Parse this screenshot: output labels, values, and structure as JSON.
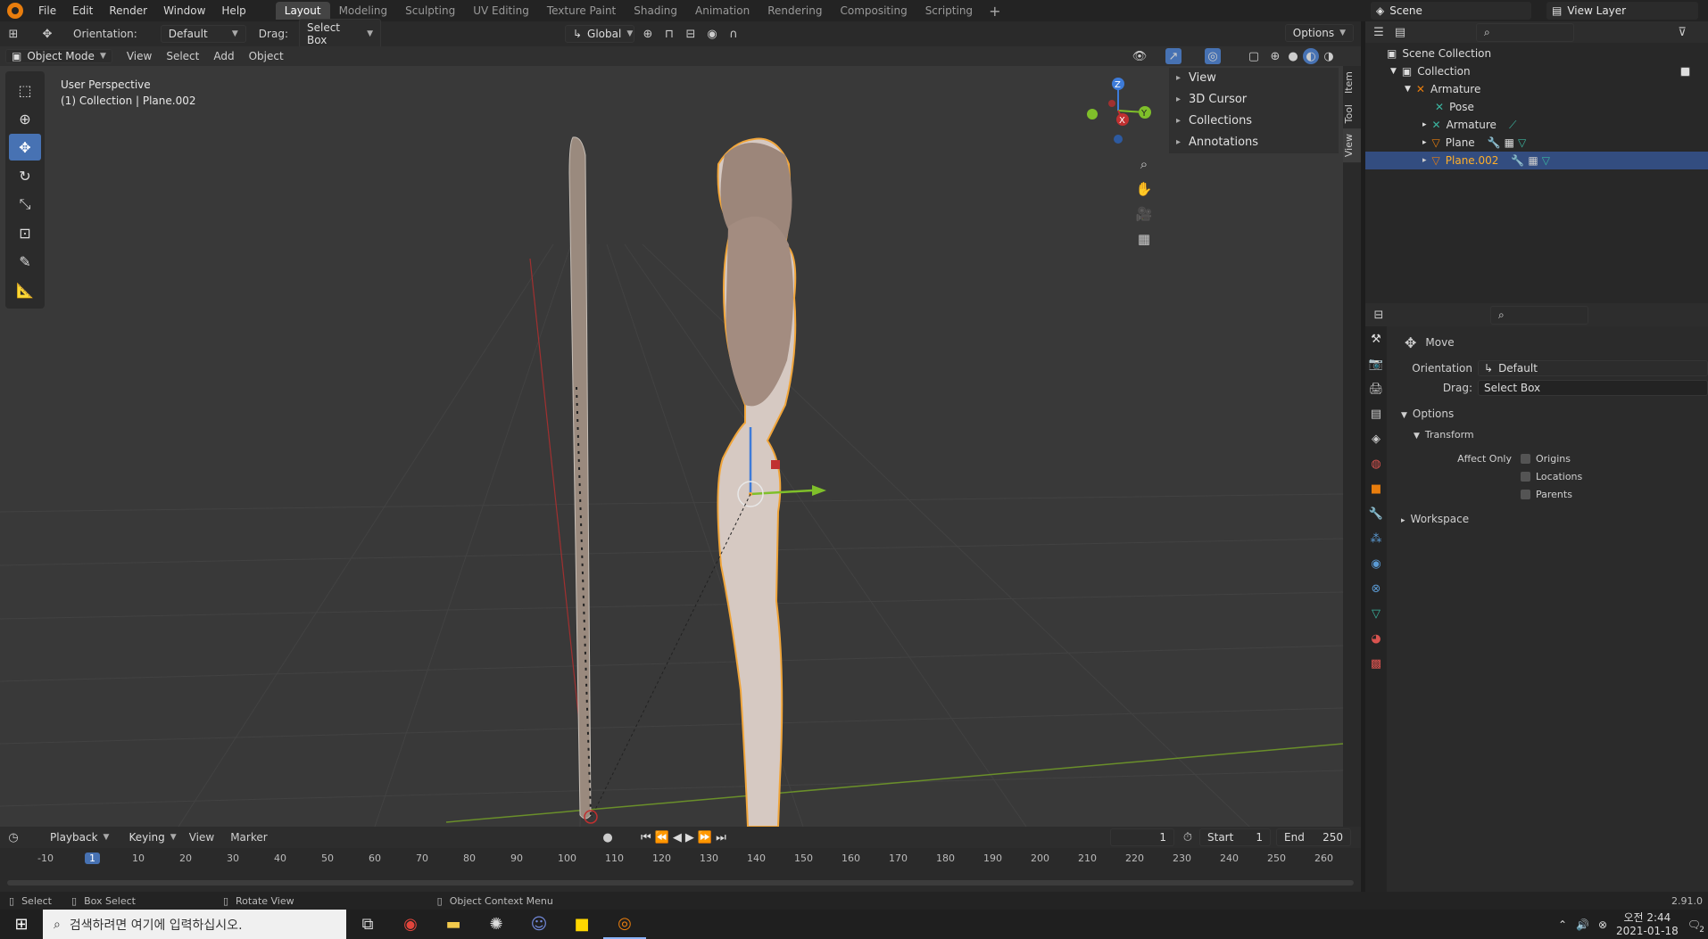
{
  "menu": [
    "File",
    "Edit",
    "Render",
    "Window",
    "Help"
  ],
  "workspaces": [
    "Layout",
    "Modeling",
    "Sculpting",
    "UV Editing",
    "Texture Paint",
    "Shading",
    "Animation",
    "Rendering",
    "Compositing",
    "Scripting"
  ],
  "scene": {
    "label": "Scene",
    "view_layer": "View Layer"
  },
  "tool_header": {
    "orientation_label": "Orientation:",
    "orientation_value": "Default",
    "drag_label": "Drag:",
    "drag_value": "Select Box",
    "transform_orientation": "Global",
    "options": "Options"
  },
  "viewport_header": {
    "mode": "Object Mode",
    "items": [
      "View",
      "Select",
      "Add",
      "Object"
    ]
  },
  "viewport": {
    "perspective": "User Perspective",
    "collection_info": "(1) Collection | Plane.002"
  },
  "npanel": {
    "items": [
      "View",
      "3D Cursor",
      "Collections",
      "Annotations"
    ],
    "tabs": [
      "Item",
      "Tool",
      "View"
    ],
    "active_tab": "View"
  },
  "outliner": {
    "rows": [
      {
        "label": "Scene Collection",
        "indent": 0
      },
      {
        "label": "Collection",
        "indent": 1
      },
      {
        "label": "Armature",
        "indent": 2
      },
      {
        "label": "Pose",
        "indent": 3
      },
      {
        "label": "Armature",
        "indent": 3
      },
      {
        "label": "Plane",
        "indent": 3
      },
      {
        "label": "Plane.002",
        "indent": 3,
        "selected": true
      }
    ]
  },
  "properties": {
    "tool_name": "Move",
    "orientation_label": "Orientation",
    "orientation_value": "Default",
    "drag_label": "Drag:",
    "drag_value": "Select Box",
    "options": "Options",
    "transform": "Transform",
    "affect_only": "Affect Only",
    "checkboxes": [
      "Origins",
      "Locations",
      "Parents"
    ],
    "workspace": "Workspace"
  },
  "timeline": {
    "menus": [
      "Playback",
      "Keying",
      "View",
      "Marker"
    ],
    "current_frame": "1",
    "start_label": "Start",
    "start": "1",
    "end_label": "End",
    "end": "250",
    "ticks": [
      "-10",
      "1",
      "10",
      "20",
      "30",
      "40",
      "50",
      "60",
      "70",
      "80",
      "90",
      "100",
      "110",
      "120",
      "130",
      "140",
      "150",
      "160",
      "170",
      "180",
      "190",
      "200",
      "210",
      "220",
      "230",
      "240",
      "250",
      "260"
    ]
  },
  "statusbar": {
    "select": "Select",
    "box_select": "Box Select",
    "rotate_view": "Rotate View",
    "context_menu": "Object Context Menu",
    "version": "2.91.0"
  },
  "taskbar": {
    "search_placeholder": "검색하려면 여기에 입력하십시오.",
    "time": "오전 2:44",
    "date": "2021-01-18",
    "notif": "2"
  },
  "colors": {
    "accent": "#4772b3",
    "selection": "#ffaf29",
    "blender_orange": "#e87d0d"
  }
}
